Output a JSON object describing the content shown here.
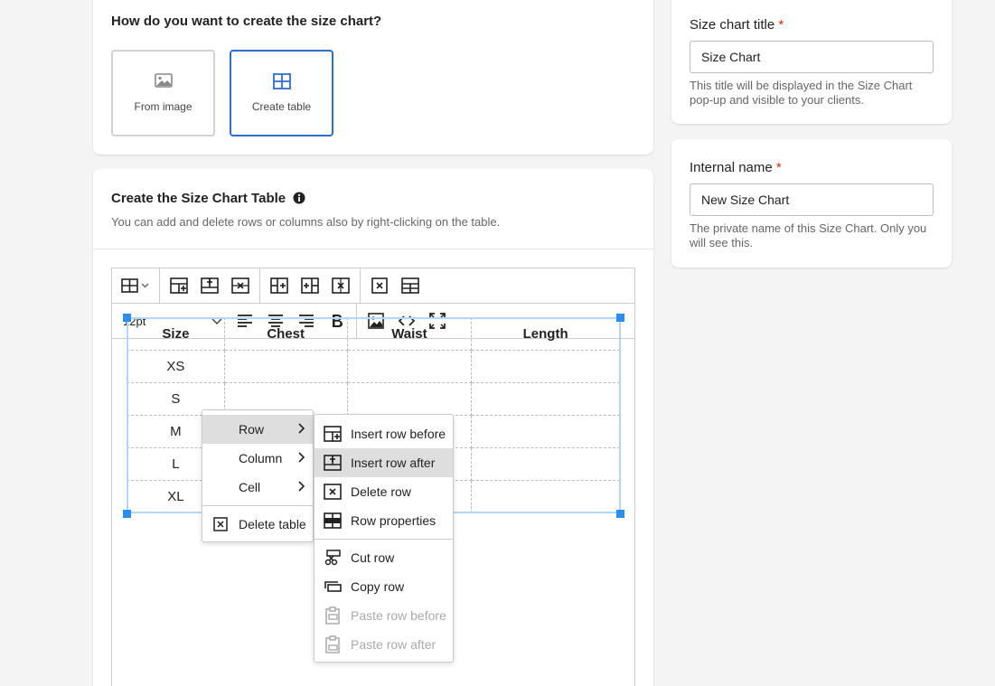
{
  "method_card": {
    "heading": "How do you want to create the size chart?",
    "options": [
      {
        "label": "From image",
        "icon": "image-icon",
        "selected": false
      },
      {
        "label": "Create table",
        "icon": "table-icon",
        "selected": true
      }
    ]
  },
  "table_card": {
    "heading": "Create the Size Chart Table",
    "info_icon": "info-icon",
    "description": "You can add and delete rows or columns also by right-clicking on the table.",
    "font_size": "12pt",
    "table": {
      "headers": [
        "Size",
        "Chest",
        "Waist",
        "Length"
      ],
      "rows": [
        [
          "XS",
          "",
          "",
          ""
        ],
        [
          "S",
          "",
          "",
          ""
        ],
        [
          "M",
          "",
          "",
          ""
        ],
        [
          "L",
          "",
          "",
          ""
        ],
        [
          "XL",
          "",
          "",
          ""
        ]
      ]
    }
  },
  "context_menu": {
    "items": [
      "Row",
      "Column",
      "Cell",
      "Delete table"
    ]
  },
  "row_submenu": {
    "items": [
      "Insert row before",
      "Insert row after",
      "Delete row",
      "Row properties",
      "Cut row",
      "Copy row",
      "Paste row before",
      "Paste row after"
    ]
  },
  "title_card": {
    "label": "Size chart title",
    "required_mark": "*",
    "value": "Size Chart",
    "help": "This title will be displayed in the Size Chart pop-up and visible to your clients."
  },
  "internal_card": {
    "label": "Internal name",
    "required_mark": "*",
    "value": "New Size Chart",
    "help": "The private name of this Size Chart. Only you will see this."
  },
  "colors": {
    "accent": "#2c6ecb",
    "selection": "#2d8cf0",
    "required": "#d72c0d"
  }
}
